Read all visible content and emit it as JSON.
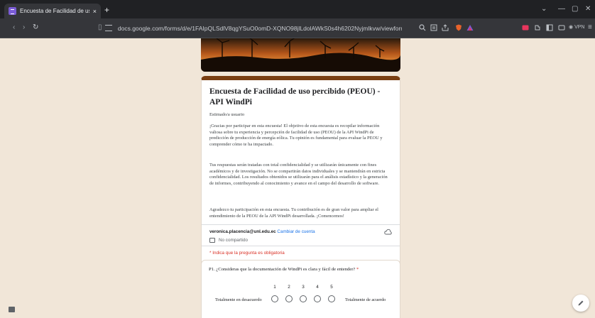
{
  "browser": {
    "tab_title": "Encuesta de Facilidad de uso p",
    "tab_close": "×",
    "new_tab": "+",
    "url": "docs.google.com/forms/d/e/1FAIpQLSdlV8qgYSuO0omD-XQNO98jlLdolAWkS0s4h6202Nyjmlkvw/viewform",
    "vpn_label": "VPN",
    "colors": {
      "tabstrip": "#202124",
      "toolbar": "#35363a",
      "accent": "#7a5bd6"
    }
  },
  "form": {
    "title": "Encuesta de Facilidad de uso percibido (PEOU) - API WindPi",
    "greeting": "Estimado/a usuario",
    "paragraph1": "¡Gracias por participar en esta encuesta! El objetivo de esta encuesta es recopilar información valiosa sobre tu experiencia y percepción de facilidad de uso (PEOU) de la API WindPi de predicción de producción de energía eólica. Tu opinión es fundamental para evaluar la PEOU y comprender cómo te ha impactado.",
    "paragraph2": "Tus respuestas serán tratadas con total confidencialidad y se utilizarán únicamente con fines académicos y de investigación. No se compartirán datos individuales y se mantendrán en estricta confidencialidad. Los resultados obtenidos se utilizarán para el análisis estadístico y la generación de informes, contribuyendo al conocimiento y avance en el campo del desarrollo de software.",
    "paragraph3": "Agradezco tu participación en esta encuesta. Tu contribución es de gran valor para ampliar el entendimiento de la PEOU de la API WindPi desarrollada. ¡Comencemos!",
    "account_email": "veronica.placencia@unl.edu.ec",
    "switch_account": "Cambiar de cuenta",
    "not_shared": "No compartido",
    "required_note": "* Indica que la pregunta es obligatoria",
    "colors": {
      "header_band": "#7a3f12",
      "page_bg": "#f1e6d8",
      "required": "#d93025",
      "link": "#1a73e8"
    }
  },
  "question1": {
    "text": "P1. ¿Consideras que la documentación de WindPi es clara y fácil de entender?",
    "required_mark": "*",
    "scale": [
      "1",
      "2",
      "3",
      "4",
      "5"
    ],
    "low_label": "Totalmente en desacuerdo",
    "high_label": "Totalmente de acuerdo"
  }
}
